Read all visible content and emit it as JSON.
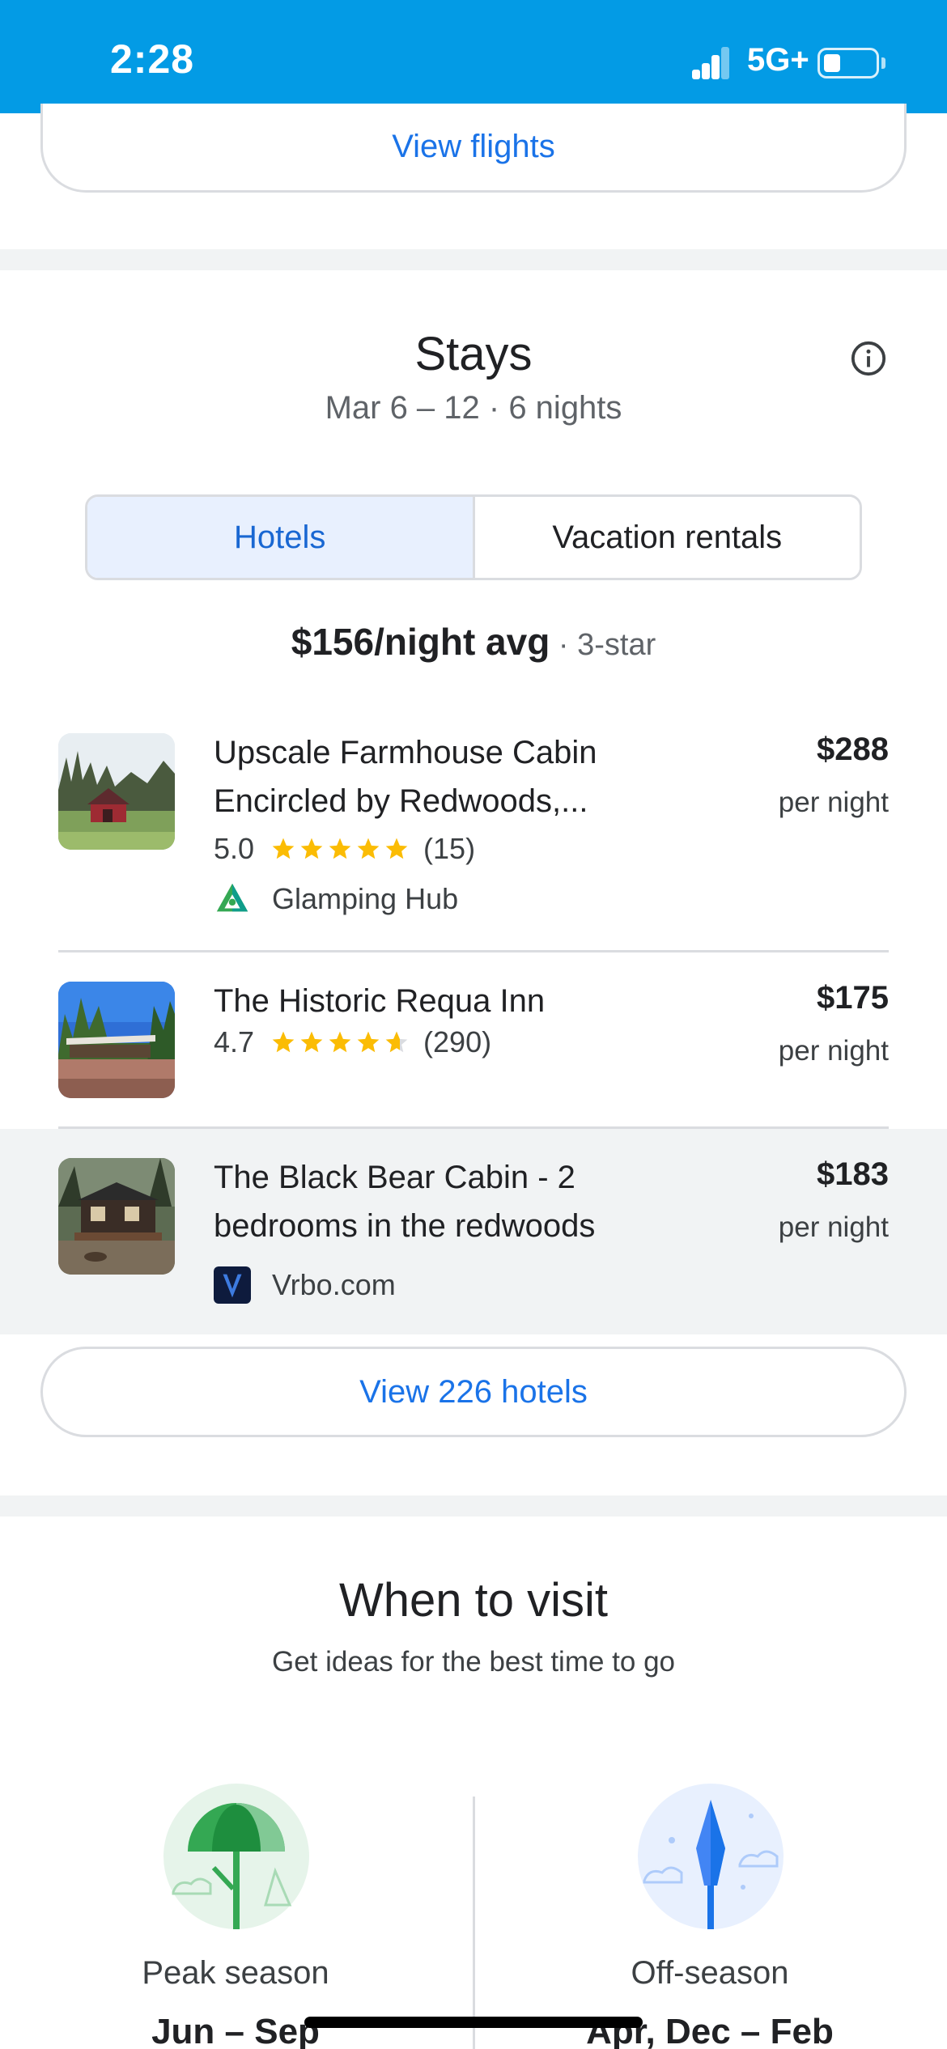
{
  "status_bar": {
    "time": "2:28",
    "network": "5G+"
  },
  "flights": {
    "button_label": "View flights"
  },
  "stays": {
    "title": "Stays",
    "subtitle": "Mar 6 – 12 · 6 nights",
    "tabs": [
      {
        "label": "Hotels",
        "selected": true
      },
      {
        "label": "Vacation rentals",
        "selected": false
      }
    ],
    "avg_price": "$156/night avg",
    "avg_separator": " · ",
    "avg_class": "3-star",
    "hotels": [
      {
        "name": "Upscale Farmhouse Cabin Encircled by Redwoods,...",
        "rating": "5.0",
        "star_rating": 5,
        "reviews": "(15)",
        "provider": "Glamping Hub",
        "price": "$288",
        "price_unit": "per night"
      },
      {
        "name": "The Historic Requa Inn",
        "rating": "4.7",
        "star_rating": 4.7,
        "reviews": "(290)",
        "provider": "",
        "price": "$175",
        "price_unit": "per night"
      },
      {
        "name": "The Black Bear Cabin - 2 bedrooms in the redwoods",
        "rating": "",
        "star_rating": 0,
        "reviews": "",
        "provider": "Vrbo.com",
        "price": "$183",
        "price_unit": "per night"
      }
    ],
    "view_all_label": "View 226 hotels"
  },
  "when_to_visit": {
    "title": "When to visit",
    "subtitle": "Get ideas for the best time to go",
    "peak": {
      "label": "Peak season",
      "range": "Jun – Sep"
    },
    "off": {
      "label": "Off-season",
      "range": "Apr, Dec – Feb"
    }
  },
  "colors": {
    "accent": "#1a73e8",
    "status_bar": "#039be5",
    "star": "#fbbc04",
    "highlight_row": "#f1f3f4"
  }
}
